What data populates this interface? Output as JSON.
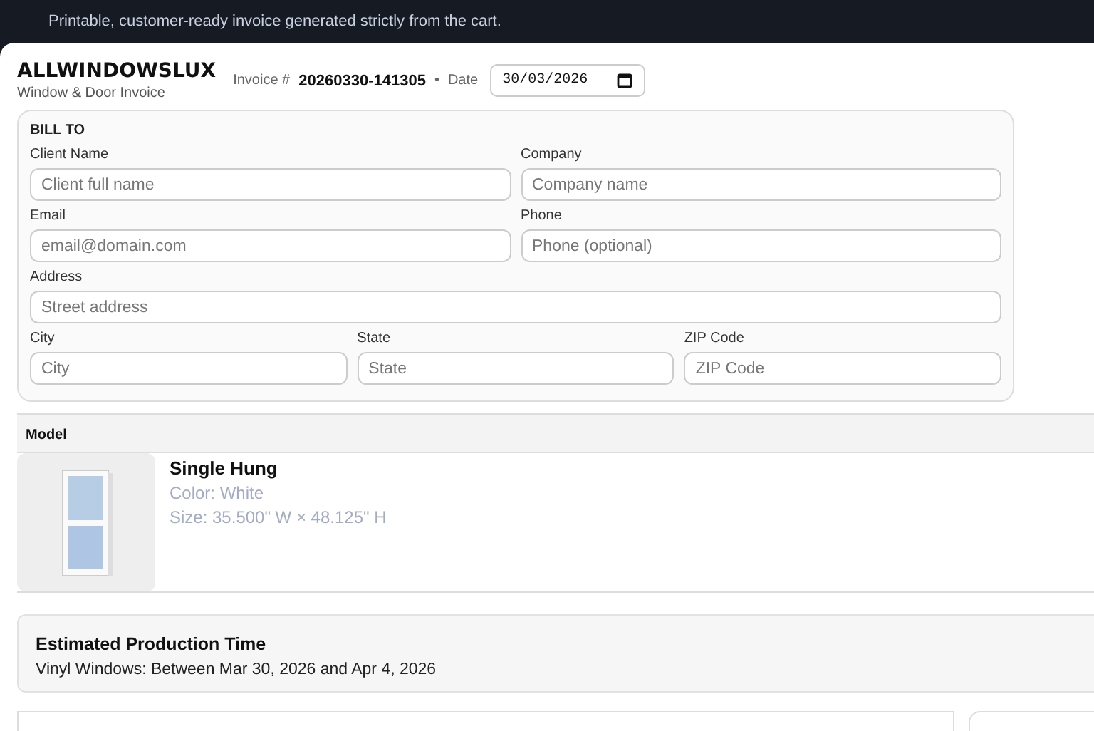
{
  "banner": {
    "text": "Printable, customer-ready invoice generated strictly from the cart."
  },
  "header": {
    "brand": "ALLWINDOWSLUX",
    "subtitle": "Window & Door Invoice",
    "invoice_label": "Invoice #",
    "invoice_number": "20260330-141305",
    "separator": "•",
    "date_label": "Date",
    "date_value": "30/03/2026"
  },
  "bill_to": {
    "title": "BILL TO",
    "rows": [
      [
        {
          "label": "Client Name",
          "placeholder": "Client full name"
        },
        {
          "label": "Company",
          "placeholder": "Company name"
        }
      ],
      [
        {
          "label": "Email",
          "placeholder": "email@domain.com"
        },
        {
          "label": "Phone",
          "placeholder": "Phone (optional)"
        }
      ],
      [
        {
          "label": "Address",
          "placeholder": "Street address"
        }
      ],
      [
        {
          "label": "City",
          "placeholder": "City"
        },
        {
          "label": "State",
          "placeholder": "State"
        },
        {
          "label": "ZIP Code",
          "placeholder": "ZIP Code"
        }
      ]
    ]
  },
  "items_table": {
    "columns": [
      "Model"
    ],
    "rows": [
      {
        "name": "Single Hung",
        "color_text": "Color: White",
        "size": "Size: 35.500\" W × 48.125\" H"
      }
    ]
  },
  "production": {
    "title": "Estimated Production Time",
    "text": "Vinyl Windows: Between Mar 30, 2026 and Apr 4, 2026"
  }
}
